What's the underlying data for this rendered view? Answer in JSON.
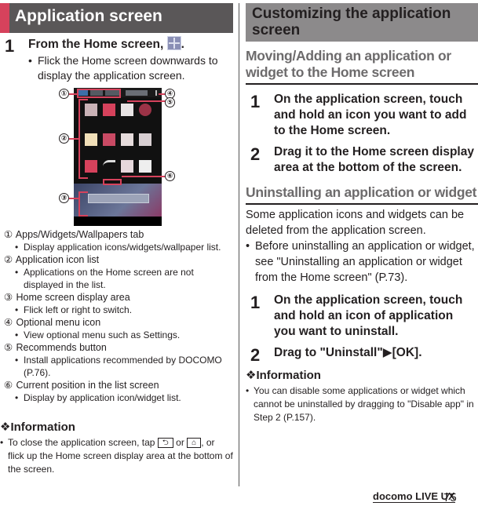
{
  "left": {
    "section_title": "Application screen",
    "step1": {
      "num": "1",
      "text": "From the Home screen,",
      "icon": "apps-grid-icon",
      "after": ".",
      "bullet": "Flick the Home screen downwards to display the application screen."
    },
    "callouts": [
      {
        "num": "①",
        "label": "Apps/Widgets/Wallpapers tab",
        "bullets": [
          "Display application icons/widgets/wallpaper list."
        ]
      },
      {
        "num": "②",
        "label": "Application icon list",
        "bullets": [
          "Applications on the Home screen are not displayed in the list."
        ]
      },
      {
        "num": "③",
        "label": "Home screen display area",
        "bullets": [
          "Flick left or right to switch."
        ]
      },
      {
        "num": "④",
        "label": "Optional menu icon",
        "bullets": [
          "View optional menu such as Settings."
        ]
      },
      {
        "num": "⑤",
        "label": "Recommends button",
        "bullets": [
          "Install applications recommended by DOCOMO (P.76)."
        ]
      },
      {
        "num": "⑥",
        "label": "Current position in the list screen",
        "bullets": [
          "Display by application icon/widget list."
        ]
      }
    ],
    "info": {
      "title": "❖Information",
      "text_before": "To close the application screen, tap",
      "key_back": "⮌",
      "or": "or",
      "key_home": "⌂",
      "text_after": ", or flick up the Home screen display area at the bottom of the screen."
    }
  },
  "right": {
    "section_title": "Customizing the application screen",
    "moving": {
      "title": "Moving/Adding an application or widget to the Home screen",
      "steps": [
        {
          "num": "1",
          "text": "On the application screen, touch and hold an icon you want to add to the Home screen."
        },
        {
          "num": "2",
          "text": "Drag it to the Home screen display area at the bottom of the screen."
        }
      ]
    },
    "uninstall": {
      "title": "Uninstalling an application or widget",
      "intro": "Some application icons and widgets can be deleted from the application screen.",
      "bullet": "Before uninstalling an application or widget, see \"Uninstalling an application or widget from the Home screen\" (P.73).",
      "steps": [
        {
          "num": "1",
          "text": "On the application screen, touch and hold an icon of application you want to uninstall."
        },
        {
          "num": "2",
          "text": "Drag to \"Uninstall\"▶[OK]."
        }
      ]
    },
    "info": {
      "title": "❖Information",
      "bullet": "You can disable some applications or widget which cannot be uninstalled by dragging to \"Disable app\" in Step 2 (P.157)."
    }
  },
  "footer": {
    "brand": "docomo LIVE UX",
    "page": "75"
  },
  "phone_callouts": [
    "①",
    "②",
    "③",
    "④",
    "⑤",
    "⑥"
  ],
  "colors": {
    "accent": "#d6425c",
    "left_header_bg": "#5a5758",
    "right_header_bg": "#8c8a8b",
    "subhead": "#6d6b6c"
  }
}
